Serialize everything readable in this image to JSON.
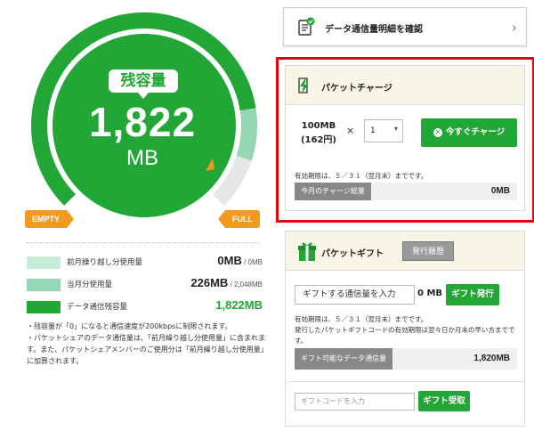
{
  "gauge": {
    "badge": "残容量",
    "value": "1,822",
    "unit": "MB",
    "empty_label": "EMPTY",
    "full_label": "FULL",
    "remaining_fraction": 0.8,
    "carryover_fraction": 0.1,
    "colors": {
      "main": "#22a635",
      "carryover": "#96d7b3",
      "track": "#e6e6e6",
      "marker": "#f29a1d"
    }
  },
  "legend": [
    {
      "label": "前月繰り越し分使用量",
      "value": "0MB",
      "total": " / 0MB",
      "color": "#c7ecd8"
    },
    {
      "label": "当月分使用量",
      "value": "226MB",
      "total": " / 2,048MB",
      "color": "#96d7b3"
    },
    {
      "label": "データ通信残容量",
      "value": "1,822MB",
      "total": "",
      "color": "#22a635"
    }
  ],
  "notes": [
    "・残容量が「0」になると通信速度が200kbpsに制限されます。",
    "・パケットシェアのデータ通信量は、「前月繰り越し分使用量」に含まれます。また、パケットシェアメンバーのご使用分は「前月繰り越し分使用量」に加算されます。"
  ],
  "detail_button": {
    "label": "データ通信量明細を確認",
    "chevron": "›"
  },
  "charge": {
    "title": "パケットチャージ",
    "amount": "100MB",
    "price": "(162円)",
    "times": "×",
    "quantity": "1",
    "button": "今すぐチャージ",
    "expiry": "有効期限は、５／３１（翌月末）までです。",
    "month_total_label": "今月のチャージ総量",
    "month_total_value": "0MB"
  },
  "gift": {
    "title": "パケットギフト",
    "history_button": "発行履歴",
    "input_label": "ギフトする通信量を入力",
    "input_unit": "0 MB",
    "issue_button": "ギフト発行",
    "note1": "有効期限は、５／３１（翌月末）までです。",
    "note2": "発行したパケットギフトコードの有効期限は翌々日か月末の早い方までです。",
    "available_label": "ギフト可能なデータ通信量",
    "available_value": "1,820MB",
    "code_placeholder": "ギフトコードを入力",
    "receive_button": "ギフト受取"
  }
}
